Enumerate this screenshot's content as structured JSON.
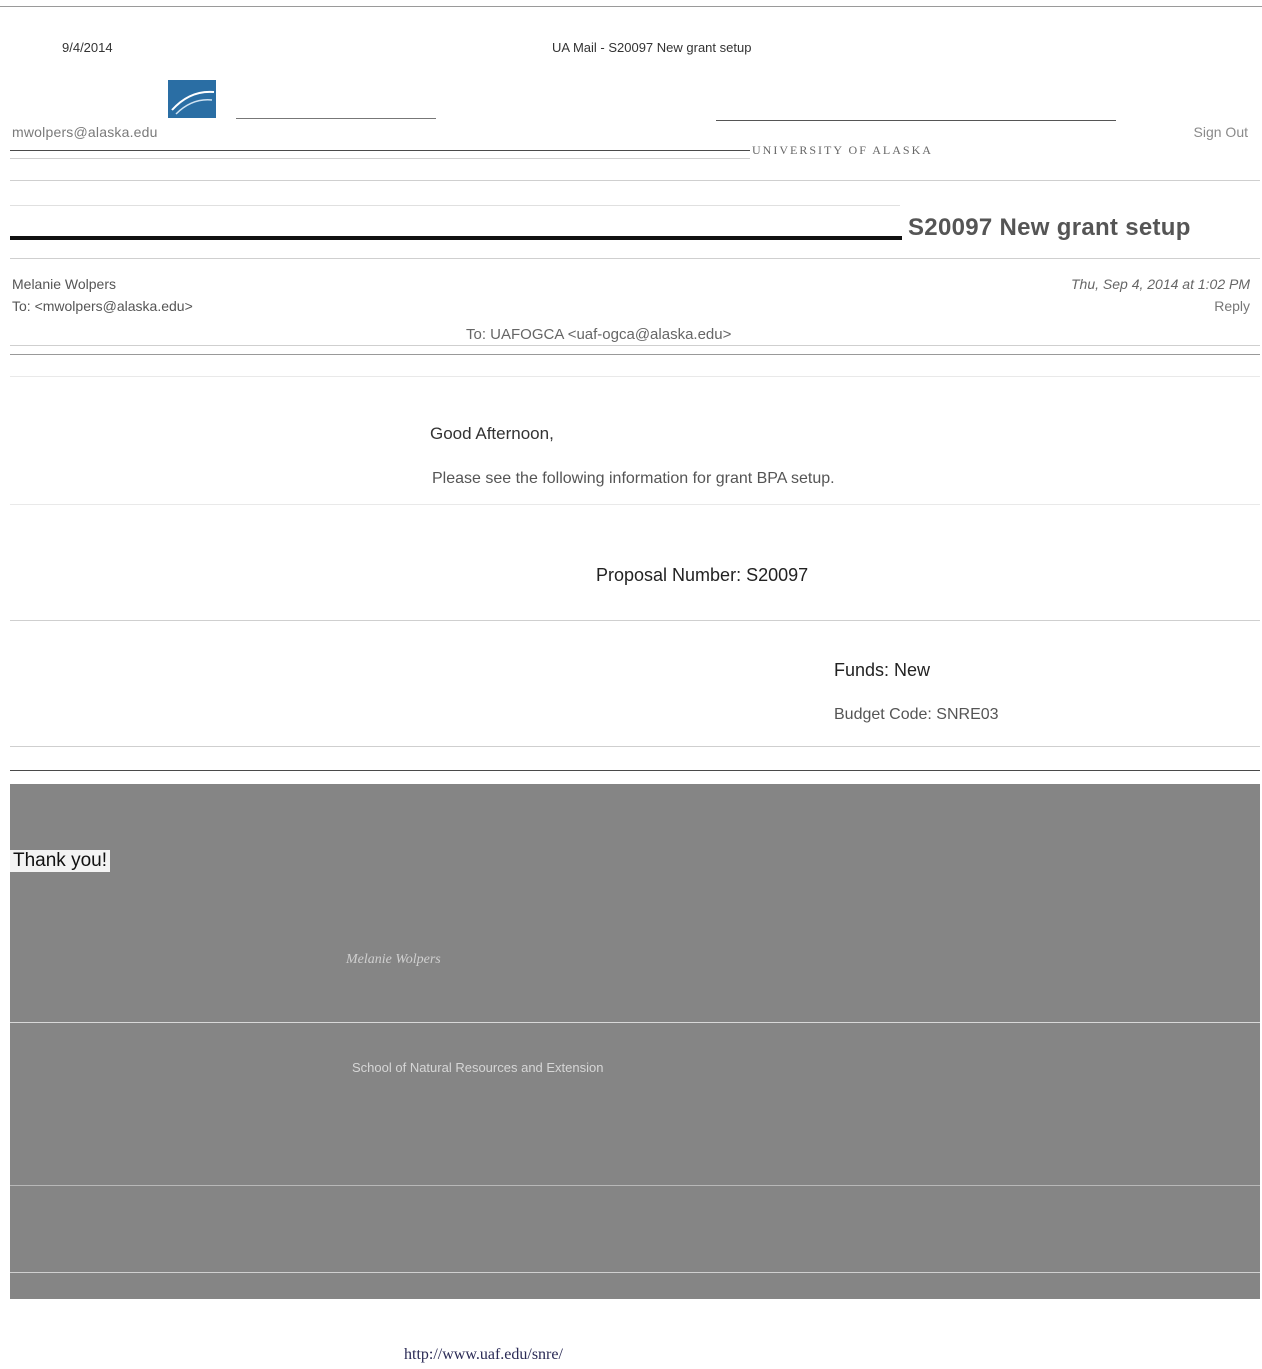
{
  "print_header": {
    "date": "9/4/2014",
    "title": "UA Mail - S20097 New grant setup"
  },
  "app": {
    "user_email": "mwolpers@alaska.edu",
    "university": "UNIVERSITY OF ALASKA",
    "sign_out": "Sign Out"
  },
  "message": {
    "subject": "S20097 New grant setup",
    "sender_name": "Melanie Wolpers",
    "sender_address": "To: <mwolpers@alaska.edu>",
    "date_sent": "Thu, Sep 4, 2014 at 1:02 PM",
    "reply_label": "Reply",
    "to_line": "To: UAFOGCA <uaf-ogca@alaska.edu>",
    "greeting": "Good Afternoon,",
    "intro": "Please see the following information for grant BPA setup.",
    "proposal_number": "Proposal Number: S20097",
    "funds": "Funds: New",
    "budget_code": "Budget Code: SNRE03",
    "thanks": "Thank you!",
    "signature_name": "Melanie Wolpers",
    "signature_detail": "School of Natural Resources and Extension",
    "footer_url": "http://www.uaf.edu/snre/"
  },
  "colors": {
    "logo_blue": "#2a6ea4",
    "band_gray": "#858585",
    "bar_black": "#111111"
  }
}
